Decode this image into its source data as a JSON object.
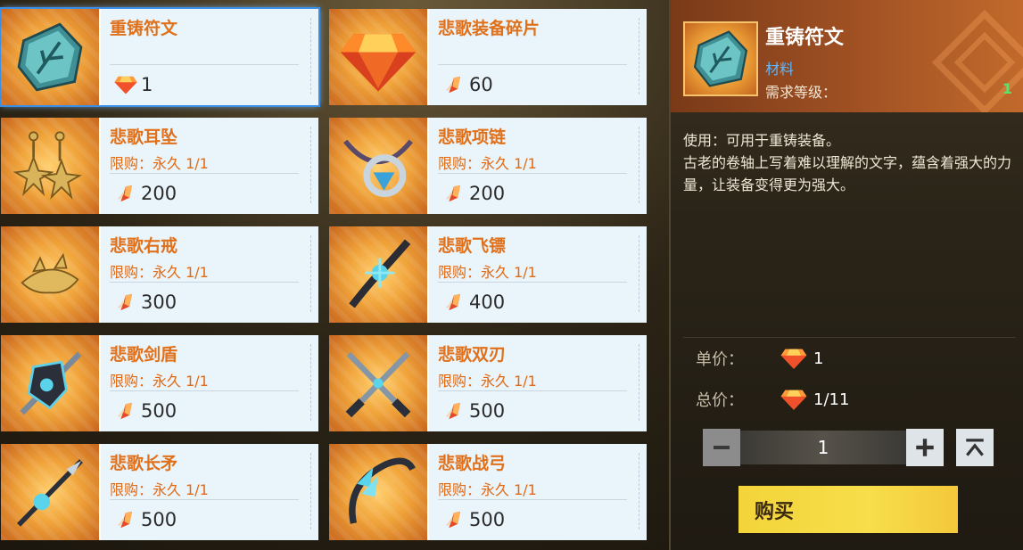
{
  "colors": {
    "accent_orange": "#e0701a",
    "card_bg": "#e9f4fb",
    "selected_outline": "#3a8ee6",
    "buy_button": "#f3d43a",
    "level_green": "#5ee06a",
    "type_blue": "#5db7ff"
  },
  "items": [
    {
      "name": "重铸符文",
      "limit": "",
      "price": "1",
      "currency_icon": "gem-icon",
      "item_icon": "rune-stone-icon",
      "selected": true
    },
    {
      "name": "悲歌装备碎片",
      "limit": "",
      "price": "60",
      "currency_icon": "shard-icon",
      "item_icon": "orange-gem-icon",
      "selected": false
    },
    {
      "name": "悲歌耳坠",
      "limit": "限购：永久 1/1",
      "price": "200",
      "currency_icon": "shard-icon",
      "item_icon": "earring-icon",
      "selected": false
    },
    {
      "name": "悲歌项链",
      "limit": "限购：永久 1/1",
      "price": "200",
      "currency_icon": "shard-icon",
      "item_icon": "necklace-icon",
      "selected": false
    },
    {
      "name": "悲歌右戒",
      "limit": "限购：永久 1/1",
      "price": "300",
      "currency_icon": "shard-icon",
      "item_icon": "ring-icon",
      "selected": false
    },
    {
      "name": "悲歌飞镖",
      "limit": "限购：永久 1/1",
      "price": "400",
      "currency_icon": "shard-icon",
      "item_icon": "dart-icon",
      "selected": false
    },
    {
      "name": "悲歌剑盾",
      "limit": "限购：永久 1/1",
      "price": "500",
      "currency_icon": "shard-icon",
      "item_icon": "sword-shield-icon",
      "selected": false
    },
    {
      "name": "悲歌双刃",
      "limit": "限购：永久 1/1",
      "price": "500",
      "currency_icon": "shard-icon",
      "item_icon": "twin-blades-icon",
      "selected": false
    },
    {
      "name": "悲歌长矛",
      "limit": "限购：永久 1/1",
      "price": "500",
      "currency_icon": "shard-icon",
      "item_icon": "spear-icon",
      "selected": false
    },
    {
      "name": "悲歌战弓",
      "limit": "限购：永久 1/1",
      "price": "500",
      "currency_icon": "shard-icon",
      "item_icon": "bow-icon",
      "selected": false
    }
  ],
  "detail": {
    "title": "重铸符文",
    "type": "材料",
    "level_label": "需求等级：",
    "level_value": "1",
    "usage": "使用：可用于重铸装备。",
    "description": "古老的卷轴上写着难以理解的文字，蕴含着强大的力量，让装备变得更为强大。",
    "unit_price_label": "单价：",
    "unit_price_value": "1",
    "total_price_label": "总价：",
    "total_price_value": "1/11",
    "quantity": "1",
    "buy_label": "购买"
  }
}
